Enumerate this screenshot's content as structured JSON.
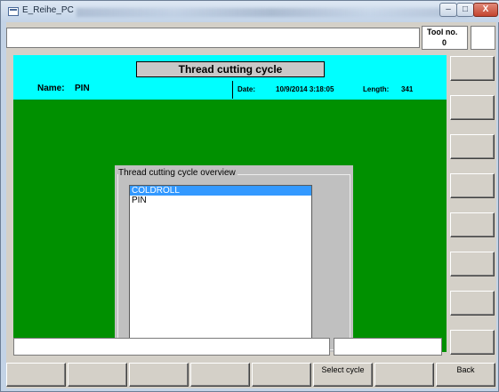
{
  "window": {
    "title": "E_Reihe_PC",
    "controls": {
      "minimize": "–",
      "maximize": "□",
      "close": "X"
    }
  },
  "tool": {
    "label": "Tool no.",
    "value": "0"
  },
  "header": {
    "title": "Thread cutting cycle",
    "name_label": "Name:",
    "name_value": "PIN",
    "date_label": "Date:",
    "date_value": "10/9/2014 3:18:05",
    "length_label": "Length:",
    "length_value": "341"
  },
  "overview": {
    "caption": "Thread cutting cycle overview",
    "items": [
      "COLDROLL",
      "PIN"
    ],
    "selected_index": 0
  },
  "side_buttons": [
    "",
    "",
    "",
    "",
    "",
    "",
    "",
    ""
  ],
  "bottom_buttons": [
    "",
    "",
    "",
    "",
    "",
    "Select cycle",
    "",
    "Back"
  ],
  "colors": {
    "panel_green": "#009000",
    "header_cyan": "#00ffff",
    "selection_blue": "#3399ff"
  }
}
